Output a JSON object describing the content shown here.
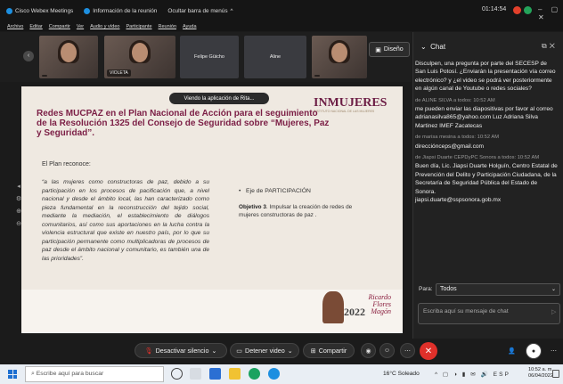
{
  "titlebar": {
    "app": "Cisco Webex Meetings",
    "info": "Información de la reunión",
    "hide": "Ocultar barra de menús",
    "hide_chevron": "^",
    "clock": "01:14:54",
    "win_controls": "– ▢ ✕"
  },
  "menu": [
    "Archivo",
    "Editar",
    "Compartir",
    "Ver",
    "Audio y vídeo",
    "Participante",
    "Reunión",
    "Ayuda"
  ],
  "participants": [
    {
      "name": ""
    },
    {
      "name": "VIOLETA"
    },
    {
      "name": "Felipe Güicho"
    },
    {
      "name": "Aline"
    },
    {
      "name": ""
    }
  ],
  "diseno_label": "Diseño",
  "viewing_text": "Viendo la aplicación de Rita...",
  "slide": {
    "logo": "INMUJERES",
    "logo_sub": "INSTITUTO NACIONAL DE LAS MUJERES",
    "title": "Redes MUCPAZ en el Plan Nacional de Acción para el seguimiento de la Resolución 1325 del Consejo de Seguridad sobre “Mujeres, Paz y Seguridad”.",
    "reconoce": "El Plan reconoce:",
    "quote": "“a las mujeres como constructoras de paz, debido a su participación en los procesos de pacificación que, a nivel nacional y desde el ámbito local, las han caracterizado como pieza fundamental en la reconstrucción del tejido social, mediante la mediación, el establecimiento de diálogos comunitarios, así como sus aportaciones en la lucha contra la violencia estructural que existe en nuestro país, por lo que su participación permanente como multiplicadoras de procesos de paz desde el ámbito nacional y comunitario, es también una de las prioridades”.",
    "eje": "Eje de PARTICIPACIÓN",
    "obj_label": "Objetivo 3",
    "obj_text": ". Impulsar la creación de redes de mujeres constructoras de paz .",
    "banner_year": "2022",
    "banner_name": "Ricardo Flores Magón"
  },
  "chat": {
    "header": "Chat",
    "messages": [
      {
        "meta": "",
        "text": "Disculpen, una pregunta por parte del SECESP de San Luis Potosí. ¿Enviarán la presentación vía correo electrónico? y ¿el video se podrá ver posteriormente en algún canal de Youtube o redes sociales?"
      },
      {
        "meta": "de ALINE SILVA a todos:   10:52 AM",
        "text": "me pueden enviar las diapositivas por  favor al correo adrianasilva865@yahoo.com          Luz Adriana Silva Martinez            IMEF Zacatecas"
      },
      {
        "meta": "de marisa mesina a todos:   10:52 AM",
        "text": "direcciónceps@gmail.com"
      },
      {
        "meta": "de Jiapsi Duarte CEPDyPC Sonora a todos:   10:52 AM",
        "text": "Buen día, Lic. Jiapsi Duarte Holguín, Centro Estatal de Prevención del Delito y Participación Ciudadana, de la Secretaría de Seguridad Pública del Estado de Sonora.\njiapsi.duarte@sspsonora.gob.mx"
      }
    ],
    "to_label": "Para:",
    "to_value": "Todos",
    "input_placeholder": "Escriba aquí su mensaje de chat"
  },
  "controls": {
    "mute": "Desactivar silencio",
    "video": "Detener video",
    "share": "Compartir"
  },
  "taskbar": {
    "search_placeholder": "Escribe aquí para buscar",
    "weather": "16°C  Soleado",
    "lang": "ESP",
    "time": "10:52 a. m.",
    "date": "06/04/2022"
  },
  "colors": {
    "accent": "#1d8fe0",
    "end_call": "#e0302a",
    "slide_title": "#7b1e45",
    "logo": "#6c1d45"
  }
}
